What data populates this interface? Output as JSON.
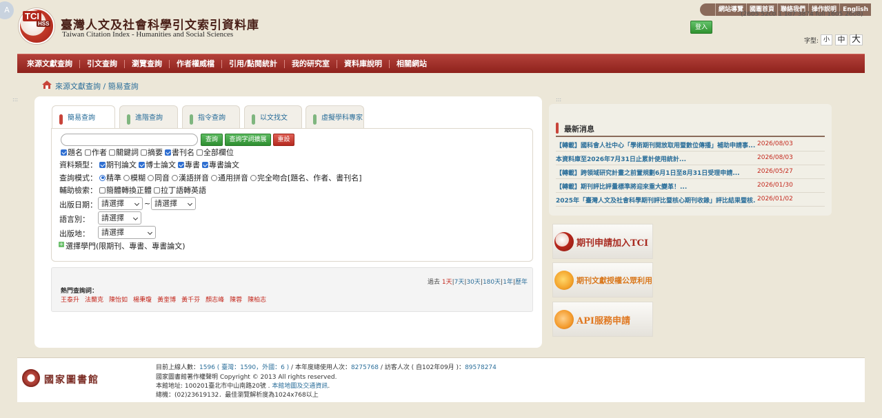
{
  "header": {
    "corner_letter": "A",
    "logo_tci": "TCI",
    "logo_hss": "HSS",
    "title": "臺灣人文及社會科學引文索引資料庫",
    "subtitle": "Taiwan Citation Index - Humanities and Social Sciences",
    "top_links": [
      "網站導覽",
      "國圖首頁",
      "聯絡我們",
      "操作説明",
      "English"
    ],
    "version_text": "(2605 52c0 1 1d7 3874 full 1605 2608)",
    "login_label": "登入",
    "font_size_label": "字型:",
    "font_sizes": [
      "小",
      "中",
      "大"
    ]
  },
  "main_nav": [
    "來源文獻查詢",
    "引文查詢",
    "瀏覽查詢",
    "作者權威檔",
    "引用/點閱統計",
    "我的研究室",
    "資料庫說明",
    "相關網站"
  ],
  "breadcrumb": {
    "root": "來源文獻查詢",
    "sep": " / ",
    "current": "簡易查詢"
  },
  "decor": {
    "dots": ":::"
  },
  "tabs": [
    "簡易查詢",
    "進階查詢",
    "指令查詢",
    "以文找文",
    "虛擬學科專家"
  ],
  "search": {
    "input_value": "",
    "btn_search": "查詢",
    "btn_expand": "查詢字詞擴展",
    "btn_reset": "重設",
    "fields": [
      {
        "label": "題名",
        "checked": true
      },
      {
        "label": "作者",
        "checked": false
      },
      {
        "label": "關鍵詞",
        "checked": false
      },
      {
        "label": "摘要",
        "checked": false
      },
      {
        "label": "書刊名",
        "checked": true
      },
      {
        "label": "全部欄位",
        "checked": false
      }
    ],
    "doc_type_label": "資料類型：",
    "doc_types": [
      {
        "label": "期刊論文",
        "checked": true
      },
      {
        "label": "博士論文",
        "checked": true
      },
      {
        "label": "專書",
        "checked": true
      },
      {
        "label": "專書論文",
        "checked": true
      }
    ],
    "mode_label": "查詢模式：",
    "modes": [
      {
        "label": "精準",
        "checked": true
      },
      {
        "label": "模糊",
        "checked": false
      },
      {
        "label": "同音",
        "checked": false
      },
      {
        "label": "漢語拼音",
        "checked": false
      },
      {
        "label": "通用拼音",
        "checked": false
      },
      {
        "label": "完全吻合[題名、作者、書刊名]",
        "checked": false
      }
    ],
    "assist_label": "輔助檢索：",
    "assists": [
      {
        "label": "簡體轉換正體",
        "checked": false
      },
      {
        "label": "拉丁語轉英語",
        "checked": false
      }
    ],
    "date_label": "出版日期：",
    "date_from": "請選擇",
    "date_sep": "~",
    "date_to": "請選擇",
    "lang_label": "語言別：",
    "lang_value": "請選擇",
    "place_label": "出版地：",
    "place_value": "請選擇",
    "plus": "+",
    "discipline": "選擇學門(限期刊、專書、專書論文)"
  },
  "popular": {
    "period_prefix": "過去",
    "periods": [
      "1天",
      "7天",
      "30天",
      "180天",
      "1年",
      "歷年"
    ],
    "title": "熱門查詢詞：",
    "terms": [
      "王泰升",
      "法蘭克",
      "陳怡如",
      "楊秉瓊",
      "黃奎博",
      "黃千芬",
      "顏志峰",
      "陳蓉",
      "陳柏志"
    ]
  },
  "news": {
    "title": "最新消息",
    "items": [
      {
        "title": "【轉載】國科會人社中心「學術期刊開放取用暨數位傳播」補助申請事...",
        "date": "2026/08/03"
      },
      {
        "title": "本資料庫至2026年7月31日止累計使用統計...",
        "date": "2026/08/03"
      },
      {
        "title": "【轉載】跨領域研究計畫之前置規劃6月1日至8月31日受理申請...",
        "date": "2026/05/27"
      },
      {
        "title": "【轉載】期刊評比評量標準將迎來重大變革！...",
        "date": "2026/01/30"
      },
      {
        "title": "2025年「臺灣人文及社會科學期刊評比暨核心期刊收錄」評比結果暨核...",
        "date": "2026/01/02"
      }
    ]
  },
  "promos": [
    {
      "label": "期刊申請加入TCI",
      "icon": "tci-logo-icon"
    },
    {
      "label": "期刊文獻授權公眾利用",
      "icon": "license-badge-icon"
    },
    {
      "label": "API服務申請",
      "icon": "api-gear-icon"
    }
  ],
  "footer": {
    "org": "國家圖書館",
    "online_label": "目前上線人數：",
    "online_total": "1596",
    "online_detail": "( 臺灣：1590，外國：6 )",
    "year_label": "/  本年度總使用人次：",
    "year_count": "8275768",
    "visitors_label": "/  訪客人次 ( 自102年09月 )：",
    "visitors_count": "89578274",
    "copyright": "國家圖書館著作權聲明 Copyright © 2013 All rights reserved.",
    "address": "本館地址: 100201臺北市中山南路20號 .",
    "map_link": "本館地圖及交通資訊",
    "map_suffix": ".",
    "phone": "總機：(02)23619132．最佳瀏覽解析度為1024x768以上"
  }
}
